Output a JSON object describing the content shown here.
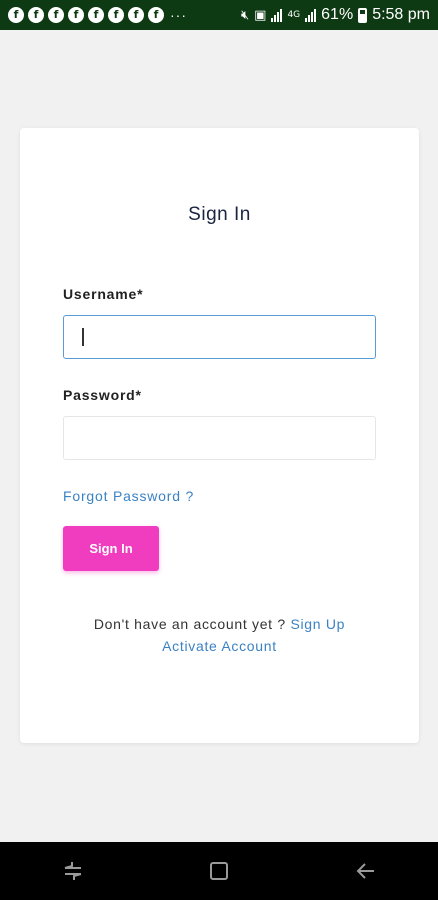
{
  "status_bar": {
    "notification_icon": "facebook-icon",
    "notification_count": 8,
    "dots": "···",
    "network": "4G",
    "battery": "61%",
    "time": "5:58 pm"
  },
  "card": {
    "title": "Sign In",
    "username_label": "Username*",
    "username_value": "",
    "password_label": "Password*",
    "password_value": "",
    "forgot_password": "Forgot Password ?",
    "signin_button": "Sign In",
    "no_account_text": "Don't have an account yet ?",
    "signup_link": "Sign Up",
    "activate_link": "Activate Account"
  },
  "nav_bar": {
    "recent_icon": "recent-apps-icon",
    "home_icon": "home-icon",
    "back_icon": "back-icon"
  },
  "colors": {
    "status_bar_bg": "#0d3a12",
    "background": "#f1f1f1",
    "card_bg": "#ffffff",
    "accent_button": "#f03cbf",
    "link": "#3b82c4",
    "focus_border": "#5b9bd5",
    "title_text": "#1b2440"
  }
}
